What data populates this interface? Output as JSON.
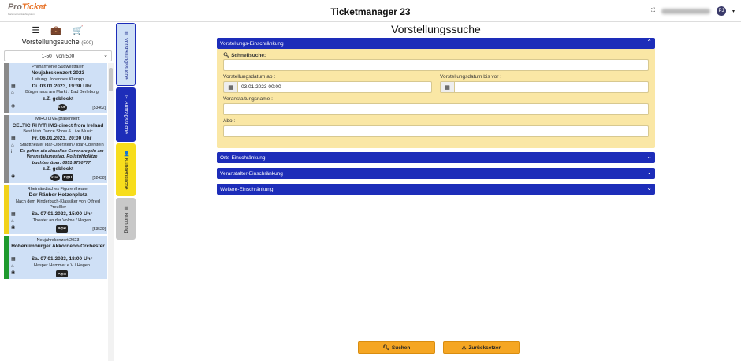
{
  "header": {
    "logo_text_a": "Pro",
    "logo_text_b": "Ticket",
    "logo_sub": "Kartenvorverkaufssystem",
    "title": "Ticketmanager 23",
    "avatar_initials": "PJ"
  },
  "sidebar": {
    "title": "Vorstellungssuche",
    "count": "(500)",
    "range_value": "1-50",
    "range_of": "von 500",
    "cards": [
      {
        "color": "#8a8a8a",
        "organizer": "Philharmonie Südwestfalen",
        "title": "Neujahrskonzert 2023",
        "subtitle": "Leitung: Johannes Klumpp",
        "date": "Di. 03.01.2023, 19:30 Uhr",
        "venue": "Bürgerhaus am Markt / Bad Berleburg",
        "status": "z.Z. geblockt",
        "badges": [
          "STOP"
        ],
        "id": "[53462]"
      },
      {
        "color": "#8a8a8a",
        "organizer": "MIRO LIVE präsentiert:",
        "title": "CELTIC RHYTHMS direct from Ireland",
        "subtitle": "Best Irish Dance Show & Live Music",
        "date": "Fr. 06.01.2023, 20:00 Uhr",
        "venue": "Stadttheater Idar-Oberstein / Idar-Oberstein",
        "note": "Es gelten die aktuellen Coronaregeln am Veranstaltungstag. Rollstuhlplätze buchbar über: 0651-9790777.",
        "status": "z.Z. geblockt",
        "badges": [
          "STOP",
          "P@H"
        ],
        "id": "[52438]"
      },
      {
        "color": "#f2d21a",
        "organizer": "Rheinländisches Figurentheater",
        "title": "Der Räuber Hotzenplotz",
        "subtitle": "Nach dem Kinderbuch-Klassiker von Otfried Preußler",
        "date": "Sa. 07.01.2023, 15:00 Uhr",
        "venue": "Theater an der Volme / Hagen",
        "badges": [
          "P@H"
        ],
        "id": "[53529]"
      },
      {
        "color": "#1f9a2e",
        "organizer": "Neujahrskonzert 2023",
        "title": "Hohenlimburger Akkordeon-Orchester",
        "subtitle": "-",
        "date": "Sa. 07.01.2023, 18:00 Uhr",
        "venue": "Hasper Hammer e.V / Hagen",
        "badges": [
          "P@H"
        ],
        "id": ""
      }
    ]
  },
  "tabs": [
    {
      "label": "Vorstellungssuche",
      "bg": "#cfe0f6",
      "fg": "#1b2a8c",
      "height": 80,
      "border": "#1d2db9"
    },
    {
      "label": "Auftragssuche",
      "bg": "#1d2db9",
      "fg": "#ffffff",
      "height": 69,
      "border": "#1d2db9"
    },
    {
      "label": "Kundensuche",
      "bg": "#f7dd1c",
      "fg": "#222222",
      "height": 67,
      "border": "#f7dd1c"
    },
    {
      "label": "Buchung",
      "bg": "#c8c8c8",
      "fg": "#333333",
      "height": 53,
      "border": "#c8c8c8"
    }
  ],
  "main": {
    "title": "Vorstellungssuche",
    "panel_open": "Vorstellungs-Einschränkung",
    "quick_label": "Schnellsuche:",
    "date_from_label": "Vorstellungsdatum ab :",
    "date_from_value": "03.01.2023 00:00",
    "date_to_label": "Vorstellungsdatum bis vor :",
    "date_to_value": "",
    "event_label": "Veranstaltungsname :",
    "abo_label": "Abo :",
    "collapsed": [
      "Orts-Einschränkung",
      "Veranstalter-Einschränkung",
      "Weitere-Einschränkung"
    ],
    "search_btn": "Suchen",
    "reset_btn": "Zurücksetzen"
  }
}
